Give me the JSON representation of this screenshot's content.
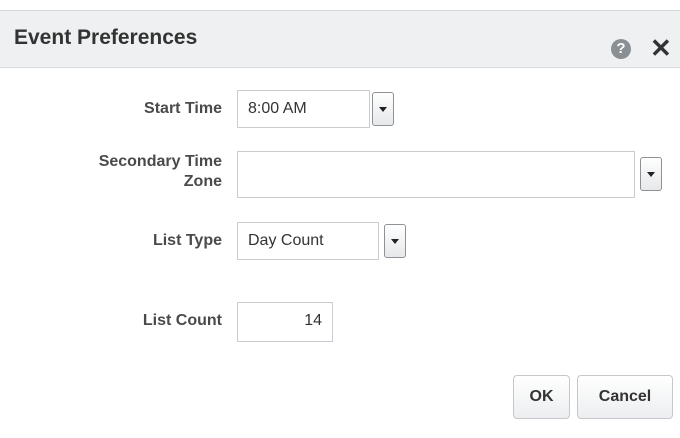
{
  "dialog": {
    "title": "Event Preferences",
    "help_icon": "?",
    "close_icon": "✕"
  },
  "form": {
    "start_time": {
      "label": "Start Time",
      "value": "8:00 AM"
    },
    "secondary_time_zone": {
      "label_line1": "Secondary Time",
      "label_line2": "Zone",
      "value": ""
    },
    "list_type": {
      "label": "List Type",
      "value": "Day Count"
    },
    "list_count": {
      "label": "List Count",
      "value": "14"
    }
  },
  "buttons": {
    "ok": "OK",
    "cancel": "Cancel"
  }
}
